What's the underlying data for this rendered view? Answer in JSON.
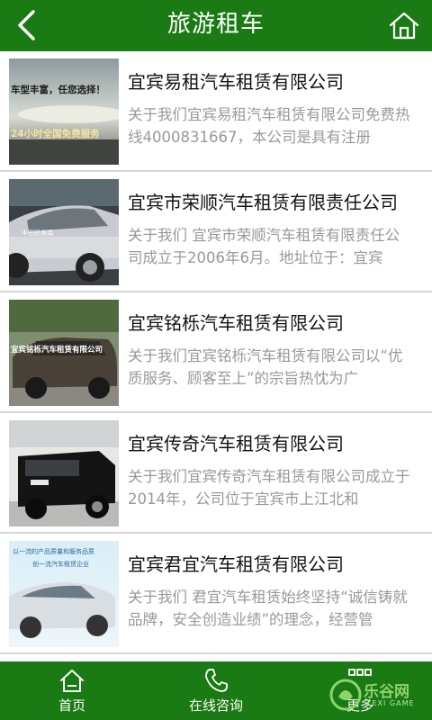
{
  "header": {
    "title": "旅游租车",
    "back_icon": "chevron-left-icon",
    "home_icon": "home-icon"
  },
  "companies": [
    {
      "name": "宜宾易租汽车租赁有限公司",
      "desc": "关于我们宜宾易租汽车租赁有限公司免费热线4000831667，本公司是具有注册",
      "image_caption_1": "车型丰富，任您选择！",
      "image_caption_2": "24小时全国免费服务"
    },
    {
      "name": "宜宾市荣顺汽车租赁有限责任公司",
      "desc": "关于我们 宜宾市荣顺汽车租赁有限责任公司成立于2006年6月。地址位于：宜宾",
      "image_caption_1": "丰田凯美瑞"
    },
    {
      "name": "宜宾铭栎汽车租赁有限公司",
      "desc": "关于我们宜宾铭栎汽车租赁有限公司以“优质服务、顾客至上”的宗旨热忱为广",
      "image_caption_1": "宜宾铭栎汽车租赁有限公司"
    },
    {
      "name": "宜宾传奇汽车租赁有限公司",
      "desc": "关于我们宜宾传奇汽车租赁有限公司成立于2014年，公司位于宜宾市上江北和"
    },
    {
      "name": "宜宾君宜汽车租赁有限公司",
      "desc": "关于我们 君宜汽车租赁始终坚持“诚信铸就品牌，安全创造业绩”的理念，经营管",
      "image_caption_1": "以一流的产品质量和服务品质",
      "image_caption_2": "创一流汽车租赁企业"
    }
  ],
  "tabbar": {
    "home_label": "首页",
    "consult_label": "在线咨询",
    "more_label": "更多"
  },
  "watermark": {
    "text": "乐谷网",
    "sub": "LEXI GAME"
  },
  "colors": {
    "brand_green": "#1a7a13",
    "desc_gray": "#999999"
  }
}
